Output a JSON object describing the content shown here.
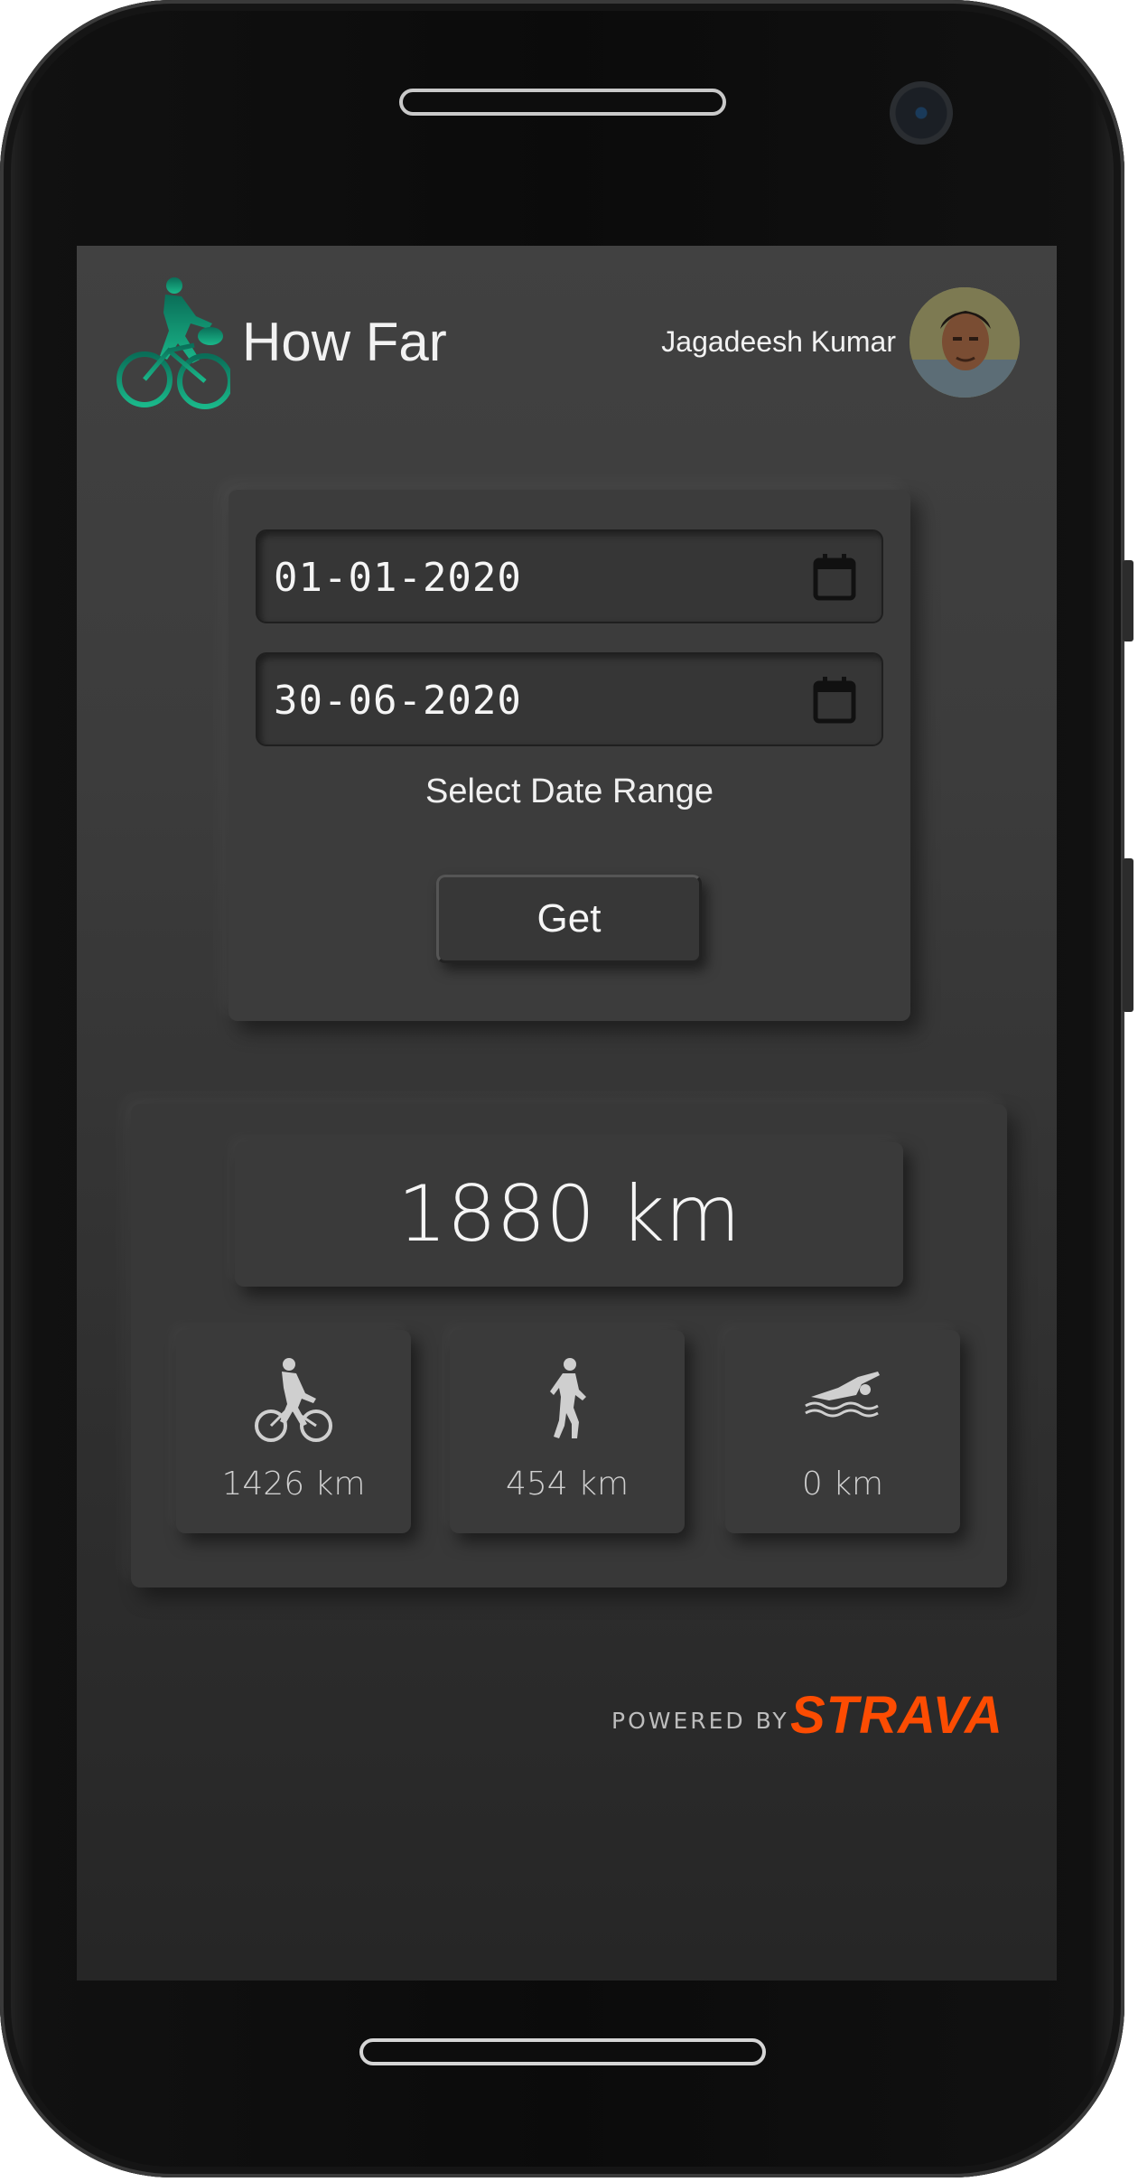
{
  "header": {
    "app_title": "How Far",
    "user_name": "Jagadeesh Kumar",
    "logo_icon": "cyclist-logo-icon"
  },
  "date_range": {
    "start_date": "01-01-2020",
    "end_date": "30-06-2020",
    "label": "Select Date Range",
    "button_label": "Get",
    "calendar_icon": "calendar-icon"
  },
  "stats": {
    "total": "1880 km",
    "activities": [
      {
        "icon": "cycling-icon",
        "value": "1426 km"
      },
      {
        "icon": "running-icon",
        "value": "454 km"
      },
      {
        "icon": "swimming-icon",
        "value": "0 km"
      }
    ]
  },
  "footer": {
    "powered_by": "POWERED BY",
    "brand": "STRAVA"
  },
  "colors": {
    "logo_gradient": [
      "#0a7a63",
      "#18c08f"
    ],
    "strava": "#fc4c02",
    "background": "#3c3c3c"
  }
}
